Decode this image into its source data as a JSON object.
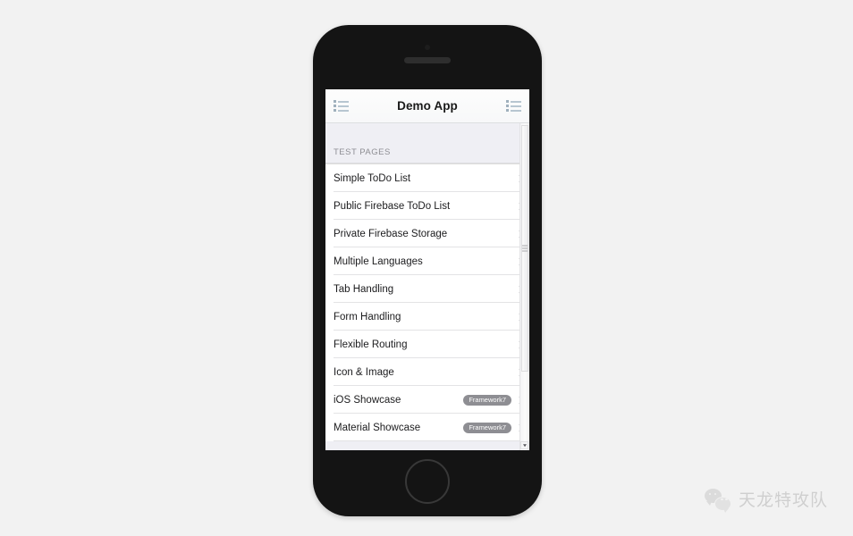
{
  "page": {
    "background_color": "#f2f2f2"
  },
  "device": {
    "name": "iphone-mockup",
    "frame_color": "#141414",
    "speaker_name": "earpiece-speaker",
    "camera_name": "front-camera",
    "home_button_name": "home-button"
  },
  "navbar": {
    "title": "Demo App",
    "left_icon": "list-icon",
    "right_icon": "list-icon"
  },
  "content": {
    "section_title": "TEST PAGES",
    "items": [
      {
        "label": "Simple ToDo List",
        "badge": ""
      },
      {
        "label": "Public Firebase ToDo List",
        "badge": ""
      },
      {
        "label": "Private Firebase Storage",
        "badge": ""
      },
      {
        "label": "Multiple Languages",
        "badge": ""
      },
      {
        "label": "Tab Handling",
        "badge": ""
      },
      {
        "label": "Form Handling",
        "badge": ""
      },
      {
        "label": "Flexible Routing",
        "badge": ""
      },
      {
        "label": "Icon & Image",
        "badge": ""
      },
      {
        "label": "iOS Showcase",
        "badge": "Framework7"
      },
      {
        "label": "Material Showcase",
        "badge": "Framework7"
      }
    ]
  },
  "scrollbar": {
    "name": "vertical-scrollbar",
    "thumb_name": "scrollbar-thumb",
    "down_arrow_name": "scroll-down-arrow"
  },
  "watermark": {
    "text": "天龙特攻队",
    "logo": "wechat-logo",
    "color": "#b4b4b4"
  }
}
